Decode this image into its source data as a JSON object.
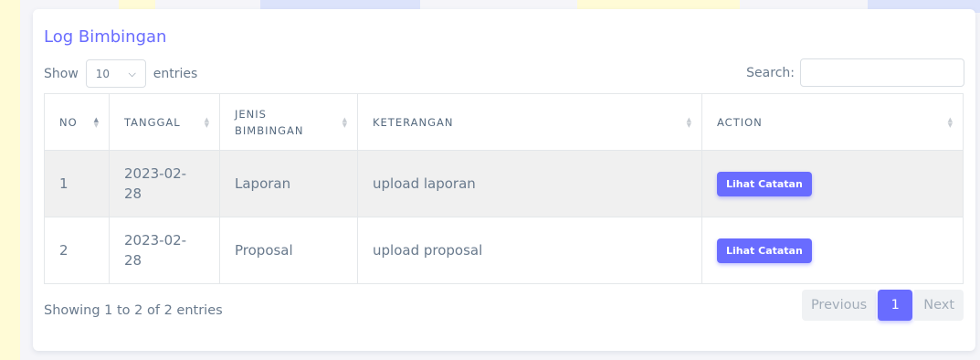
{
  "card": {
    "title": "Log Bimbingan"
  },
  "length": {
    "show_label": "Show",
    "value": "10",
    "entries_label": "entries"
  },
  "search": {
    "label": "Search:",
    "placeholder": ""
  },
  "table": {
    "headers": [
      "NO",
      "TANGGAL",
      "JENIS BIMBINGAN",
      "KETERANGAN",
      "ACTION"
    ],
    "header_tanggal_line1": "TANGGAL",
    "header_jenis_line1": "JENIS",
    "header_jenis_line2": "BIMBINGAN",
    "rows": [
      {
        "no": "1",
        "tanggal_a": "2023-02-",
        "tanggal_b": "28",
        "jenis": "Laporan",
        "keterangan": "upload laporan",
        "action": "Lihat Catatan"
      },
      {
        "no": "2",
        "tanggal_a": "2023-02-",
        "tanggal_b": "28",
        "jenis": "Proposal",
        "keterangan": "upload proposal",
        "action": "Lihat Catatan"
      }
    ]
  },
  "info": "Showing 1 to 2 of 2 entries",
  "pagination": {
    "previous": "Previous",
    "current": "1",
    "next": "Next"
  },
  "colors": {
    "accent": "#696cff",
    "striped_row": "#f0f0f0"
  },
  "icons": {
    "select": "chevron-down-icon",
    "sort": "sort-icon"
  }
}
